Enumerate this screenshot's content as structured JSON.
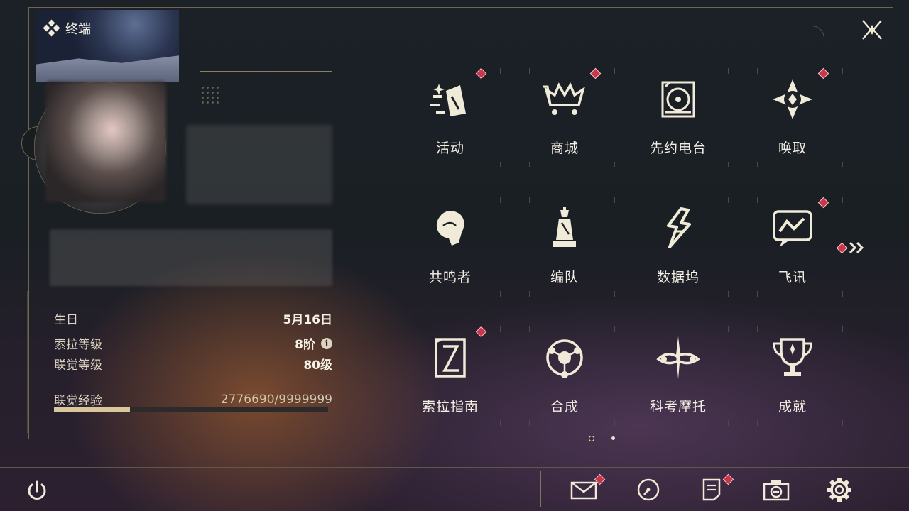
{
  "header": {
    "title": "终端"
  },
  "profile": {
    "stats": [
      {
        "label": "生日",
        "value": "5月16日"
      },
      {
        "label": "索拉等级",
        "value": "8阶"
      },
      {
        "label": "联觉等级",
        "value": "80级"
      }
    ],
    "exp": {
      "label": "联觉经验",
      "value": "2776690/9999999",
      "fraction": 0.2777
    }
  },
  "grid": {
    "items": [
      {
        "label": "活动",
        "icon": "activity-icon",
        "badge": true
      },
      {
        "label": "商城",
        "icon": "shop-icon",
        "badge": true
      },
      {
        "label": "先约电台",
        "icon": "radio-icon",
        "badge": false
      },
      {
        "label": "唤取",
        "icon": "gacha-icon",
        "badge": true
      },
      {
        "label": "共鸣者",
        "icon": "resonator-icon",
        "badge": false
      },
      {
        "label": "编队",
        "icon": "team-icon",
        "badge": false
      },
      {
        "label": "数据坞",
        "icon": "databank-icon",
        "badge": false
      },
      {
        "label": "飞讯",
        "icon": "message-icon",
        "badge": true
      },
      {
        "label": "索拉指南",
        "icon": "guide-icon",
        "badge": true
      },
      {
        "label": "合成",
        "icon": "synthesis-icon",
        "badge": false
      },
      {
        "label": "科考摩托",
        "icon": "motorcycle-icon",
        "badge": false
      },
      {
        "label": "成就",
        "icon": "trophy-icon",
        "badge": false
      }
    ],
    "pages": 2,
    "current_page": 1
  },
  "bottom_bar": {
    "icons": [
      {
        "name": "mail-icon",
        "badge": true
      },
      {
        "name": "clock-icon",
        "badge": false
      },
      {
        "name": "notice-icon",
        "badge": true
      },
      {
        "name": "camera-icon",
        "badge": false
      },
      {
        "name": "settings-icon",
        "badge": false
      }
    ]
  },
  "colors": {
    "accent": "#d9c79c",
    "badge": "#c8374a",
    "text": "#f3efe4"
  }
}
